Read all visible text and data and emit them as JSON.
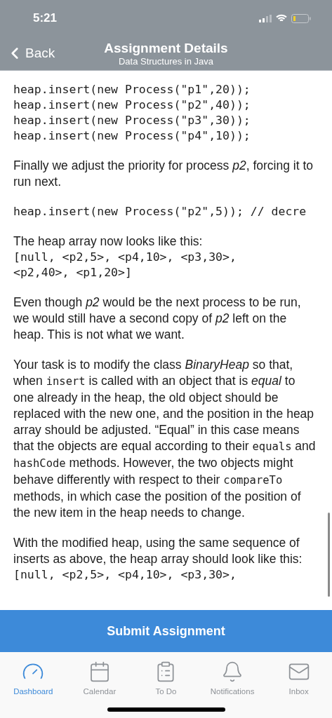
{
  "status_bar": {
    "time": "5:21"
  },
  "nav": {
    "back": "Back",
    "title": "Assignment Details",
    "subtitle": "Data Structures in Java"
  },
  "blocks": [
    {
      "kind": "code",
      "lines": [
        "heap.insert(new Process(\"p1\",20));",
        "heap.insert(new Process(\"p2\",40));",
        "heap.insert(new Process(\"p3\",30));",
        "heap.insert(new Process(\"p4\",10));"
      ]
    },
    {
      "kind": "text",
      "segments": [
        {
          "kind": "text",
          "text": "Finally we adjust the priority for process *p2*, forcing it to run next."
        }
      ]
    },
    {
      "kind": "code",
      "lines": [
        "heap.insert(new Process(\"p2\",5)); // decre"
      ]
    },
    {
      "kind": "text",
      "segments": [
        {
          "kind": "text",
          "text": "The heap array now looks like this:"
        }
      ]
    },
    {
      "kind": "array",
      "lines": [
        "[null, <p2,5>, <p4,10>, <p3,30>,",
        "<p2,40>, <p1,20>]"
      ]
    },
    {
      "kind": "text",
      "segments": [
        {
          "kind": "text",
          "text": "Even though *p2* would be the next process to be run, we would still have a second copy of *p2* left on the heap. This is not what we want."
        }
      ]
    },
    {
      "kind": "text",
      "segments": [
        {
          "kind": "text",
          "text": "Your task is to modify the class *BinaryHeap* so that, when "
        },
        {
          "kind": "code",
          "text": "insert"
        },
        {
          "kind": "text",
          "text": " is called with an object that is *equal* to one already in the heap, the old object should be replaced with the new one, and the position in the heap array should be adjusted. “Equal” in this case means that the objects are equal according to their "
        },
        {
          "kind": "code",
          "text": "equals"
        },
        {
          "kind": "text",
          "text": " and "
        },
        {
          "kind": "code",
          "text": "hashCode"
        },
        {
          "kind": "text",
          "text": " methods. However, the two objects might behave differently with respect to their "
        },
        {
          "kind": "code",
          "text": "compareTo"
        },
        {
          "kind": "text",
          "text": " methods, in which case the position of the position of the new item in the heap needs to change."
        }
      ]
    },
    {
      "kind": "text",
      "segments": [
        {
          "kind": "text",
          "text": "With the modified heap, using the same sequence of inserts as above, the heap array should look like this:"
        }
      ]
    },
    {
      "kind": "array",
      "lines": [
        "[null, <p2,5>, <p4,10>, <p3,30>,"
      ]
    }
  ],
  "submit": "Submit Assignment",
  "tabs": [
    {
      "kind": "gauge",
      "label": "Dashboard",
      "selected": true
    },
    {
      "kind": "calendar",
      "label": "Calendar",
      "selected": false
    },
    {
      "kind": "todo",
      "label": "To Do",
      "selected": false
    },
    {
      "kind": "bell",
      "label": "Notifications",
      "selected": false
    },
    {
      "kind": "mail",
      "label": "Inbox",
      "selected": false
    }
  ]
}
